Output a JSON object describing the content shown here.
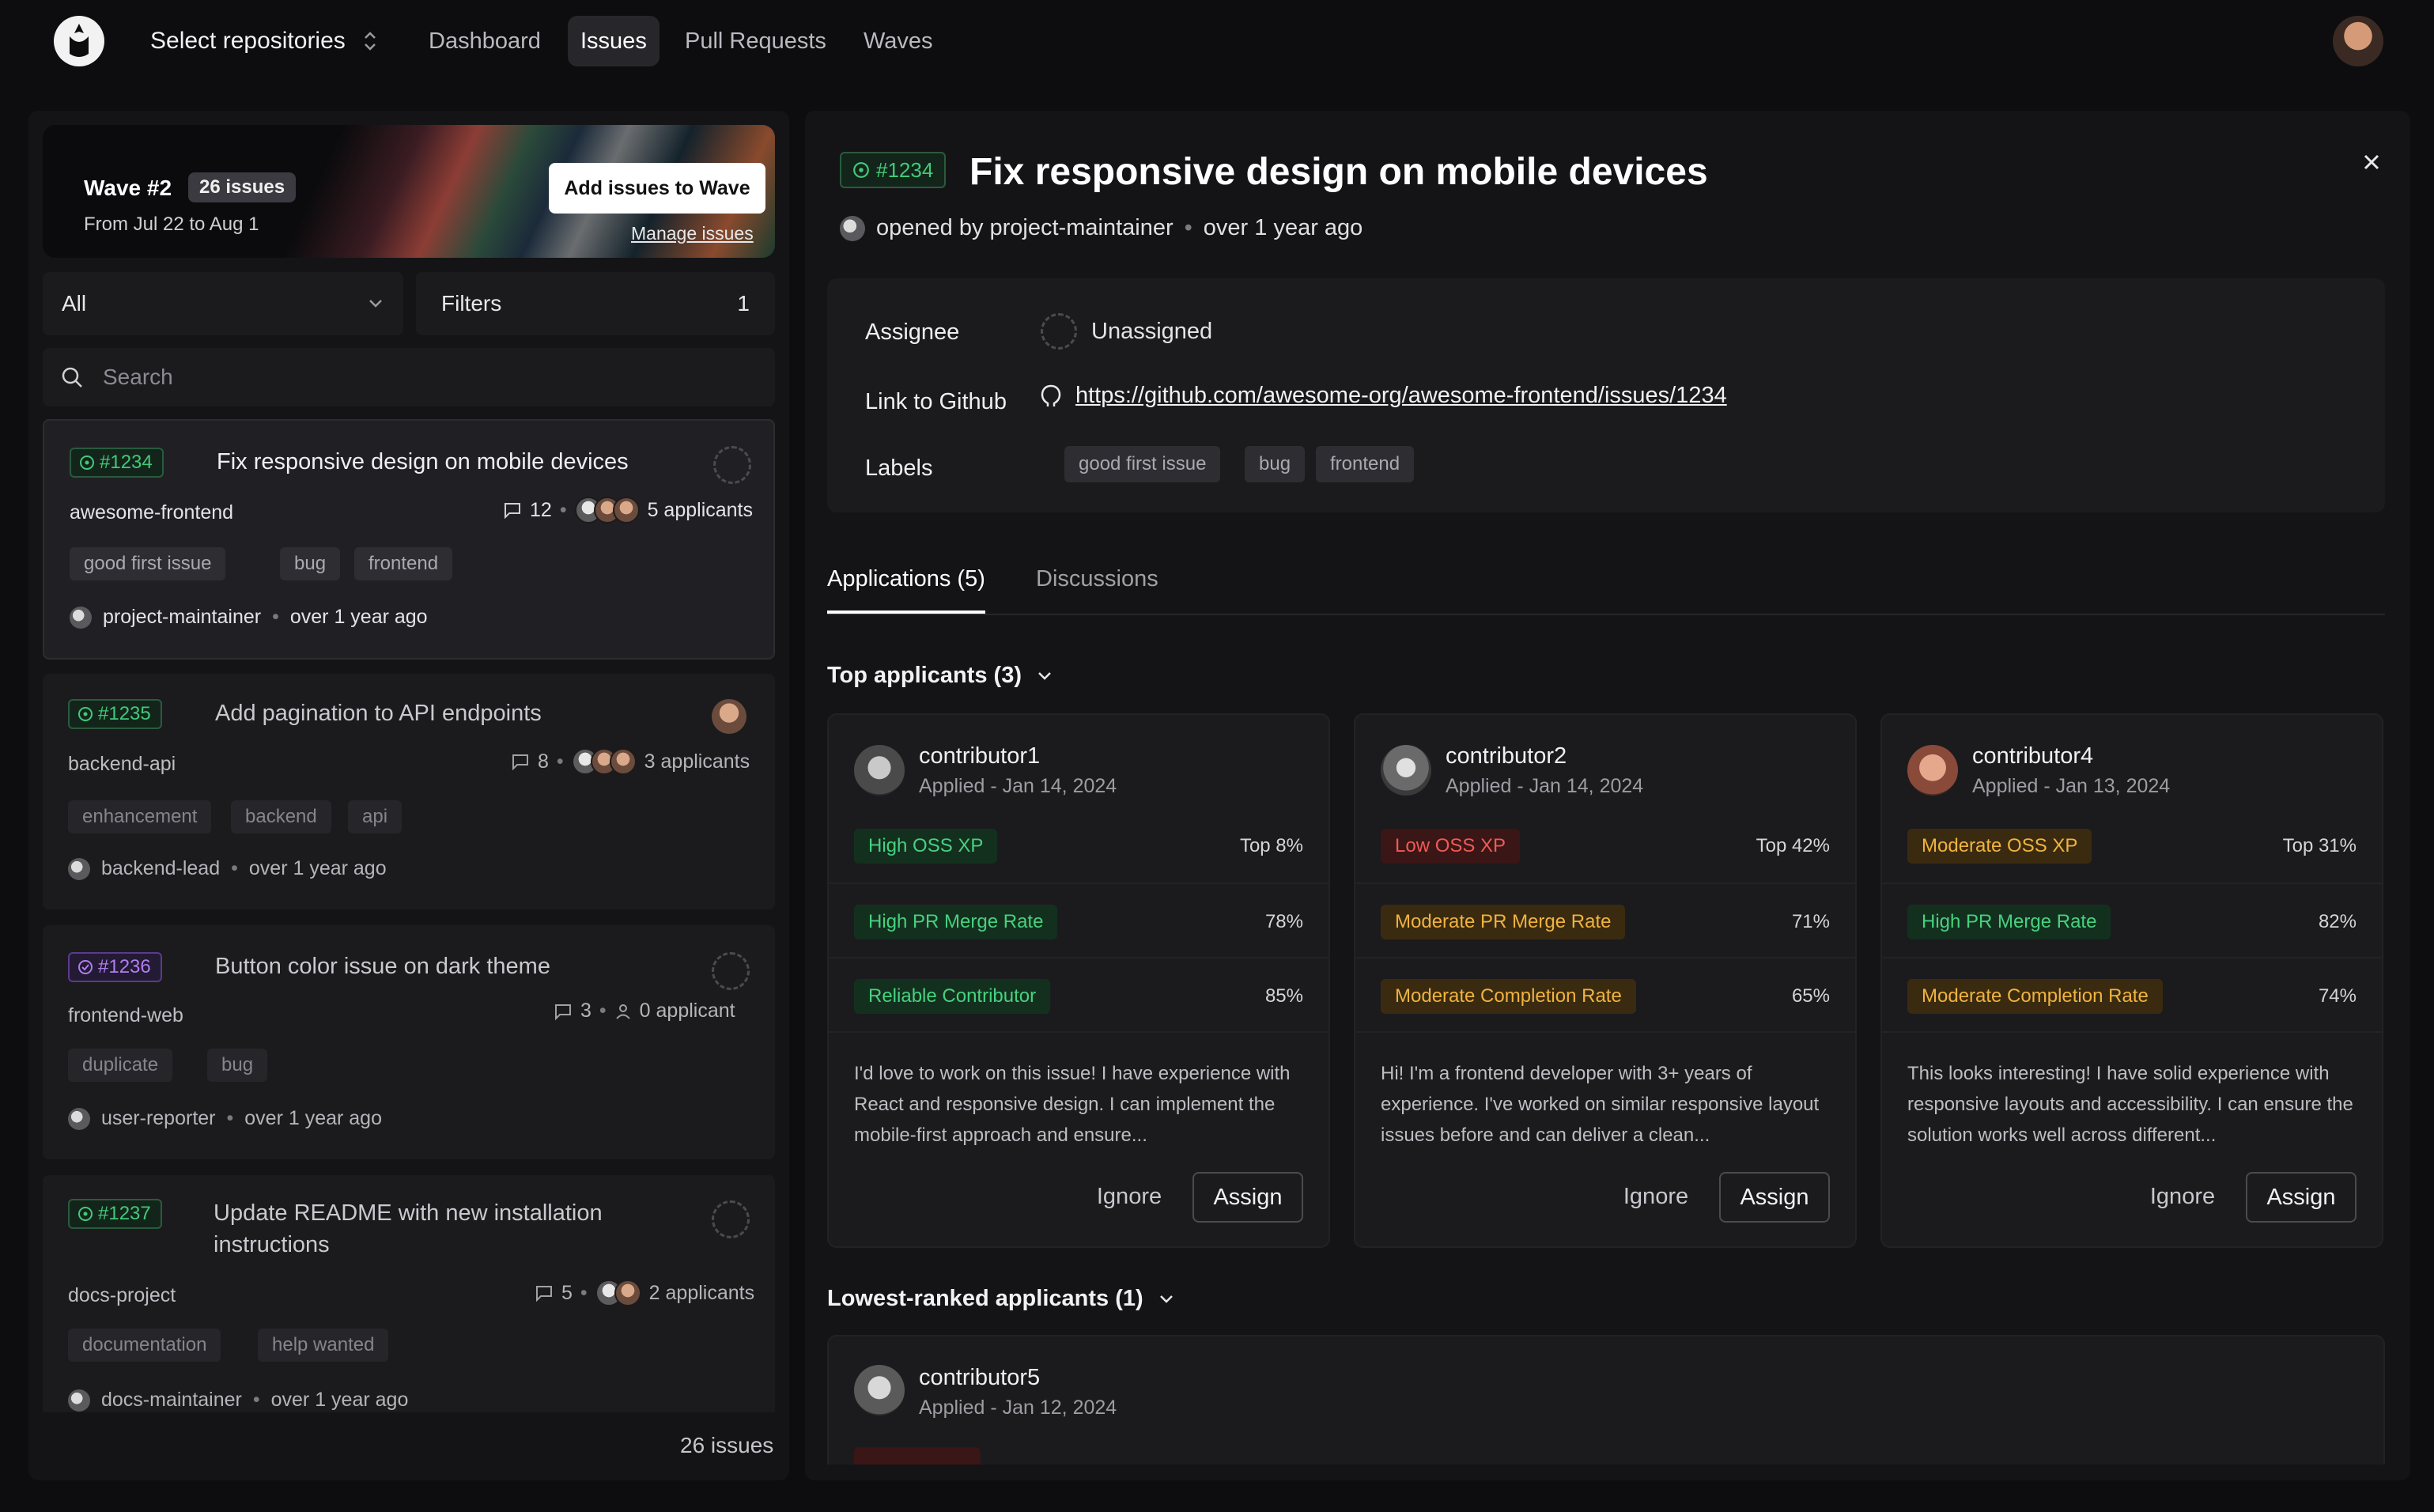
{
  "nav": {
    "repo_select": "Select repositories",
    "links": [
      "Dashboard",
      "Issues",
      "Pull Requests",
      "Waves"
    ]
  },
  "wave": {
    "title": "Wave #2",
    "badge": "26 issues",
    "dates": "From Jul 22 to Aug 1",
    "add_button": "Add issues to Wave",
    "manage_link": "Manage issues"
  },
  "filters": {
    "status_select": "All",
    "filters_label": "Filters",
    "filters_count": "1",
    "search_placeholder": "Search"
  },
  "issues": [
    {
      "number": "#1234",
      "title": "Fix responsive design on mobile devices",
      "repo": "awesome-frontend",
      "comments": "12",
      "applicants": "5 applicants",
      "tags": [
        "good first issue",
        "bug",
        "frontend"
      ],
      "author": "project-maintainer",
      "time": "over 1 year ago"
    },
    {
      "number": "#1235",
      "title": "Add pagination to API endpoints",
      "repo": "backend-api",
      "comments": "8",
      "applicants": "3 applicants",
      "tags": [
        "enhancement",
        "backend",
        "api"
      ],
      "author": "backend-lead",
      "time": "over 1 year ago"
    },
    {
      "number": "#1236",
      "title": "Button color issue on dark theme",
      "repo": "frontend-web",
      "comments": "3",
      "applicants": "0 applicant",
      "tags": [
        "duplicate",
        "bug"
      ],
      "author": "user-reporter",
      "time": "over 1 year ago"
    },
    {
      "number": "#1237",
      "title": "Update README with new installation instructions",
      "repo": "docs-project",
      "comments": "5",
      "applicants": "2 applicants",
      "tags": [
        "documentation",
        "help wanted"
      ],
      "author": "docs-maintainer",
      "time": "over 1 year ago"
    }
  ],
  "issues_count": "26 issues",
  "detail": {
    "number": "#1234",
    "title": "Fix responsive design on mobile devices",
    "opened_by": "opened by project-maintainer",
    "opened_time": "over 1 year ago",
    "assignee_label": "Assignee",
    "assignee_value": "Unassigned",
    "link_label": "Link to Github",
    "link_value": "https://github.com/awesome-org/awesome-frontend/issues/1234",
    "labels_label": "Labels",
    "labels": [
      "good first issue",
      "bug",
      "frontend"
    ],
    "tabs": [
      "Applications (5)",
      "Discussions"
    ],
    "top_header": "Top applicants (3)",
    "low_header": "Lowest-ranked applicants (1)"
  },
  "applicants": [
    {
      "name": "contributor1",
      "date": "Applied - Jan 14, 2024",
      "metrics": [
        {
          "label": "High OSS XP",
          "value": "Top 8%",
          "color": "green"
        },
        {
          "label": "High PR Merge Rate",
          "value": "78%",
          "color": "green"
        },
        {
          "label": "Reliable Contributor",
          "value": "85%",
          "color": "green"
        }
      ],
      "message": "I'd love to work on this issue! I have experience with React and responsive design. I can implement the mobile-first approach and ensure..."
    },
    {
      "name": "contributor2",
      "date": "Applied - Jan 14, 2024",
      "metrics": [
        {
          "label": "Low OSS XP",
          "value": "Top 42%",
          "color": "red"
        },
        {
          "label": "Moderate PR Merge Rate",
          "value": "71%",
          "color": "amber"
        },
        {
          "label": "Moderate Completion Rate",
          "value": "65%",
          "color": "amber"
        }
      ],
      "message": "Hi! I'm a frontend developer with 3+ years of experience. I've worked on similar responsive layout issues before and can deliver a clean..."
    },
    {
      "name": "contributor4",
      "date": "Applied - Jan 13, 2024",
      "metrics": [
        {
          "label": "Moderate OSS XP",
          "value": "Top 31%",
          "color": "amber"
        },
        {
          "label": "High PR Merge Rate",
          "value": "82%",
          "color": "green"
        },
        {
          "label": "Moderate Completion Rate",
          "value": "74%",
          "color": "amber"
        }
      ],
      "message": "This looks interesting! I have solid experience with responsive layouts and accessibility. I can ensure the solution works well across different..."
    }
  ],
  "low_applicant": {
    "name": "contributor5",
    "date": "Applied - Jan 12, 2024"
  },
  "actions": {
    "ignore": "Ignore",
    "assign": "Assign"
  }
}
